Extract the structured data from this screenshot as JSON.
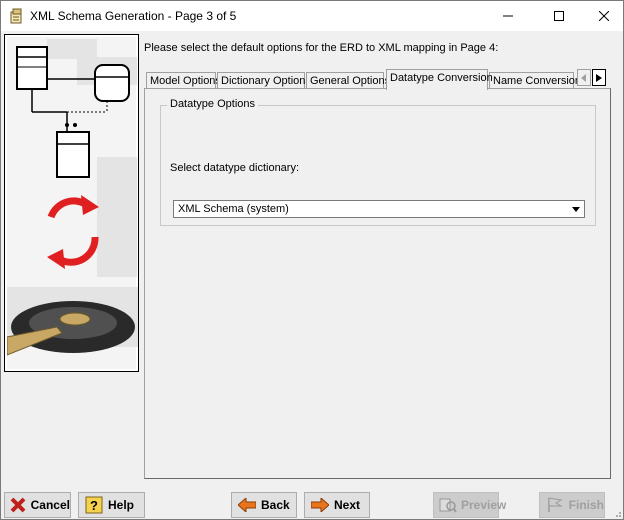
{
  "window": {
    "title": "XML Schema Generation - Page 3 of 5",
    "controls": [
      "minimize-icon",
      "maximize-icon",
      "close-icon"
    ]
  },
  "instruction": "Please select the default options for the ERD to XML mapping in Page 4:",
  "tabs": [
    {
      "label": "Model Options",
      "active": false
    },
    {
      "label": "Dictionary Options",
      "active": false
    },
    {
      "label": "General Options",
      "active": false
    },
    {
      "label": "Datatype Conversion",
      "active": true
    },
    {
      "label": "Name Conversion",
      "active": false
    }
  ],
  "datatype_options": {
    "group_title": "Datatype Options",
    "select_label": "Select datatype dictionary:",
    "selected_dictionary": "XML Schema (system)"
  },
  "buttons": {
    "cancel": "Cancel",
    "help": "Help",
    "back": "Back",
    "next": "Next",
    "preview": "Preview",
    "finish": "Finish"
  },
  "colors": {
    "cancel_icon": "#c0201a",
    "back_next_icon": "#e8741c",
    "disabled_text": "#a0a0a0",
    "refresh_arrows": "#e02020"
  }
}
